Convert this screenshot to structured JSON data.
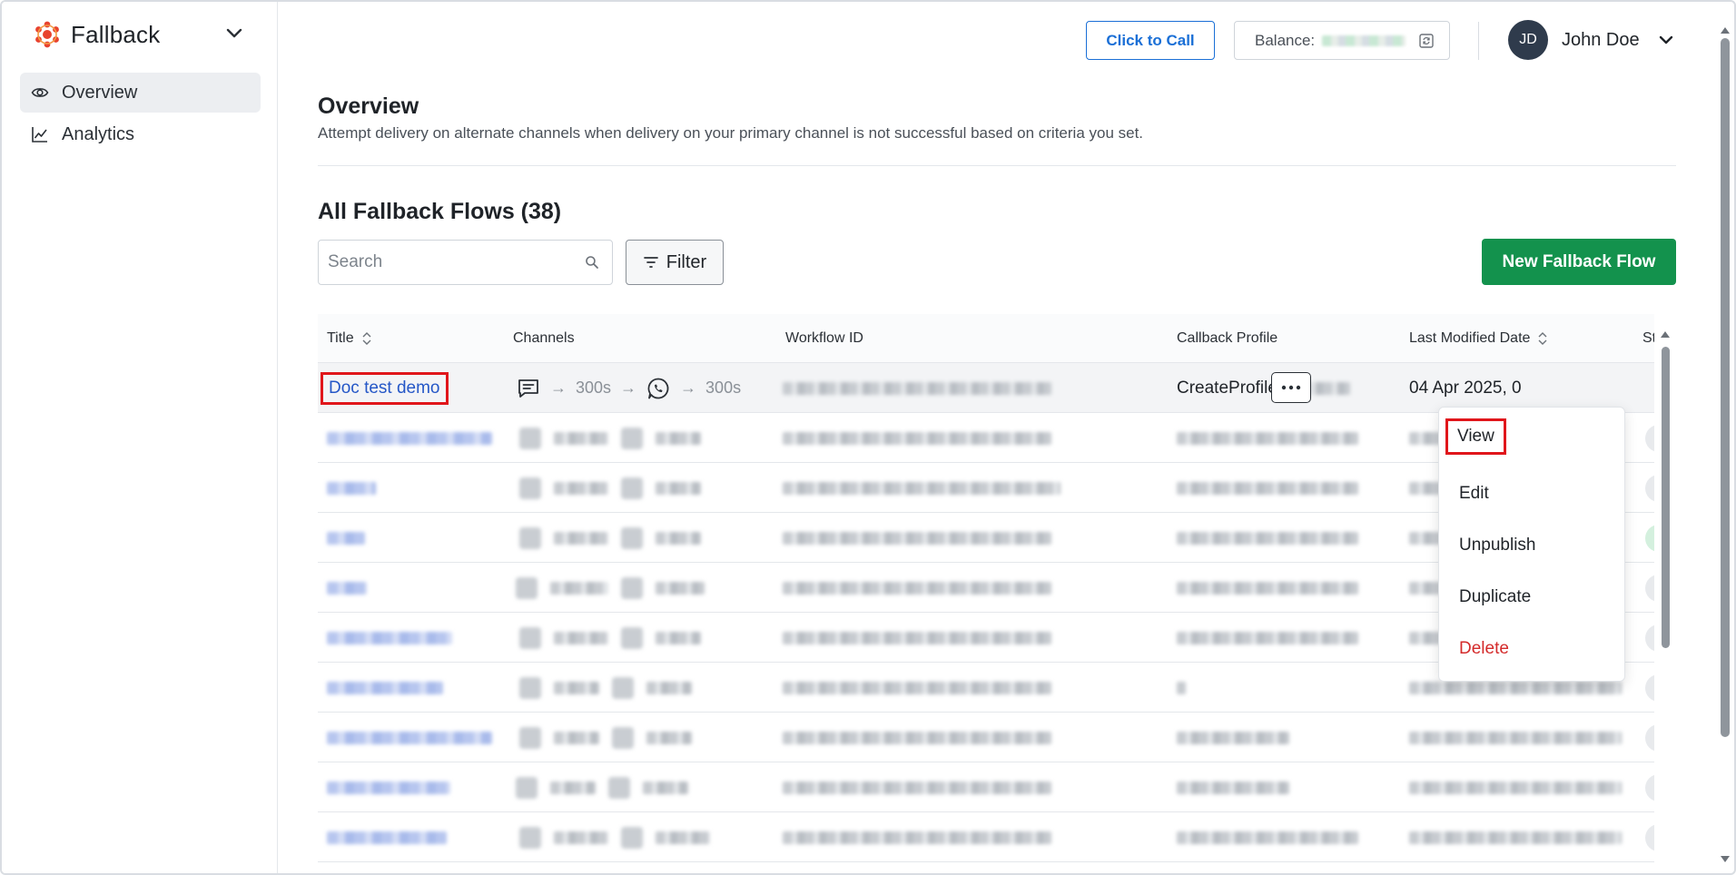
{
  "app": {
    "name": "Fallback",
    "accent": "#13924d",
    "link_color": "#2557c7",
    "danger_color": "#d42b2b"
  },
  "sidebar": {
    "items": [
      {
        "label": "Overview",
        "icon": "eye-icon",
        "active": true
      },
      {
        "label": "Analytics",
        "icon": "line-chart-icon",
        "active": false
      }
    ]
  },
  "header": {
    "call_label": "Click to Call",
    "balance_label": "Balance:",
    "user_initials": "JD",
    "user_name": "John Doe"
  },
  "overview": {
    "title": "Overview",
    "description": "Attempt delivery on alternate channels when delivery on your primary channel is not successful based on criteria you set."
  },
  "flows": {
    "title": "All Fallback Flows (38)",
    "search_placeholder": "Search",
    "filter_label": "Filter",
    "new_label": "New Fallback Flow",
    "columns": [
      "Title",
      "Channels",
      "Workflow ID",
      "Callback Profile",
      "Last Modified Date",
      "St"
    ],
    "first_row": {
      "title": "Doc test demo",
      "channel_delay_1": "300s",
      "channel_delay_2": "300s",
      "callback_profile": "CreateProfile",
      "last_modified": "04 Apr 2025, 0"
    }
  },
  "row_menu": {
    "items": [
      "View",
      "Edit",
      "Unpublish",
      "Duplicate",
      "Delete"
    ]
  }
}
